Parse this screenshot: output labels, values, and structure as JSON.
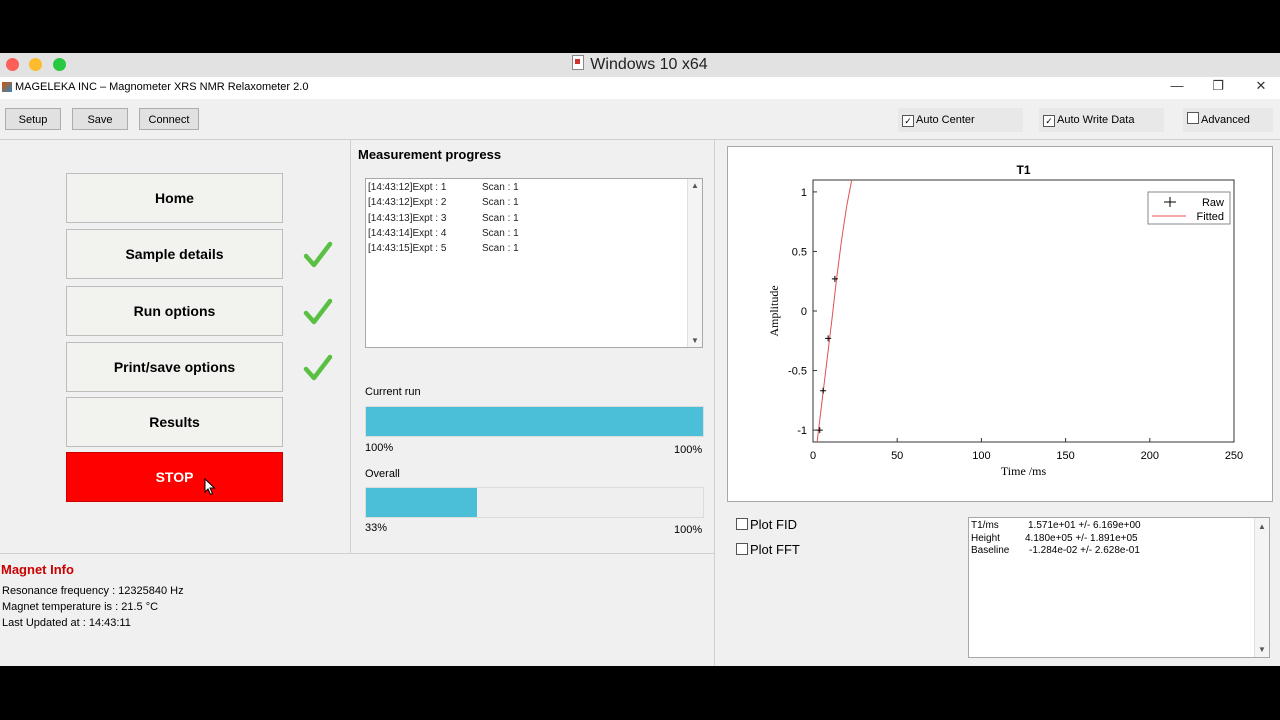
{
  "host": {
    "title": "Windows 10 x64",
    "traffic_colors": [
      "#fc5f57",
      "#fdbc2e",
      "#28c840"
    ]
  },
  "window": {
    "title": "MAGELEKA INC – Magnometer XRS NMR Relaxometer 2.0",
    "minimize": "—",
    "restore": "❐",
    "close": "✕"
  },
  "toolbar": {
    "setup": "Setup",
    "save": "Save",
    "connect": "Connect",
    "auto_center": {
      "label": "Auto Center",
      "checked": true
    },
    "auto_write": {
      "label": "Auto Write Data",
      "checked": true
    },
    "advanced": {
      "label": "Advanced",
      "checked": false
    }
  },
  "nav": {
    "items": [
      {
        "label": "Home",
        "done": false
      },
      {
        "label": "Sample details",
        "done": true
      },
      {
        "label": "Run options",
        "done": true
      },
      {
        "label": "Print/save options",
        "done": true
      },
      {
        "label": "Results",
        "done": false
      }
    ],
    "stop": "STOP",
    "check_color": "#5ac043",
    "stop_color": "#ff0000"
  },
  "progress": {
    "title": "Measurement progress",
    "log": [
      {
        "time": "[14:43:12]Expt : 1",
        "scan": "Scan : 1"
      },
      {
        "time": "[14:43:12]Expt : 2",
        "scan": "Scan : 1"
      },
      {
        "time": "[14:43:13]Expt : 3",
        "scan": "Scan : 1"
      },
      {
        "time": "[14:43:14]Expt : 4",
        "scan": "Scan : 1"
      },
      {
        "time": "[14:43:15]Expt : 5",
        "scan": "Scan : 1"
      }
    ],
    "current_run": {
      "label": "Current run",
      "value_text": "100%",
      "max_text": "100%",
      "fraction": 1.0
    },
    "overall": {
      "label": "Overall",
      "value_text": "33%",
      "max_text": "100%",
      "fraction": 0.33
    },
    "bar_color": "#4bbfd8"
  },
  "magnet": {
    "title": "Magnet Info",
    "resonance": "Resonance frequency : 12325840 Hz",
    "temperature": "Magnet temperature is : 21.5 °C",
    "updated": "Last Updated at : 14:43:11",
    "title_color": "#cc0000"
  },
  "chart_data": {
    "type": "line",
    "title": "T1",
    "xlabel": "Time /ms",
    "ylabel": "Amplitude",
    "xlim": [
      0,
      250
    ],
    "ylim": [
      -1.1,
      1.1
    ],
    "xticks": [
      0,
      50,
      100,
      150,
      200,
      250
    ],
    "yticks": [
      -1,
      -0.5,
      0,
      0.5,
      1
    ],
    "legend_position": "top-right",
    "series": [
      {
        "name": "Raw",
        "marker": "+",
        "color": "#000000",
        "x": [
          4,
          6,
          9,
          13
        ],
        "y": [
          -1.0,
          -0.67,
          -0.23,
          0.27
        ]
      },
      {
        "name": "Fitted",
        "color": "#e05050",
        "x": [
          2,
          5,
          8,
          11,
          14,
          17,
          20,
          23
        ],
        "y": [
          -1.15,
          -0.8,
          -0.45,
          -0.1,
          0.27,
          0.6,
          0.88,
          1.1
        ]
      }
    ]
  },
  "plot_options": {
    "fid": {
      "label": "Plot FID",
      "checked": false
    },
    "fft": {
      "label": "Plot FFT",
      "checked": false
    }
  },
  "fit_results": [
    {
      "name": "T1/ms",
      "value": "1.571e+01 +/- 6.169e+00"
    },
    {
      "name": "Height",
      "value": "4.180e+05 +/- 1.891e+05"
    },
    {
      "name": "Baseline",
      "value": "-1.284e-02 +/- 2.628e-01"
    }
  ]
}
